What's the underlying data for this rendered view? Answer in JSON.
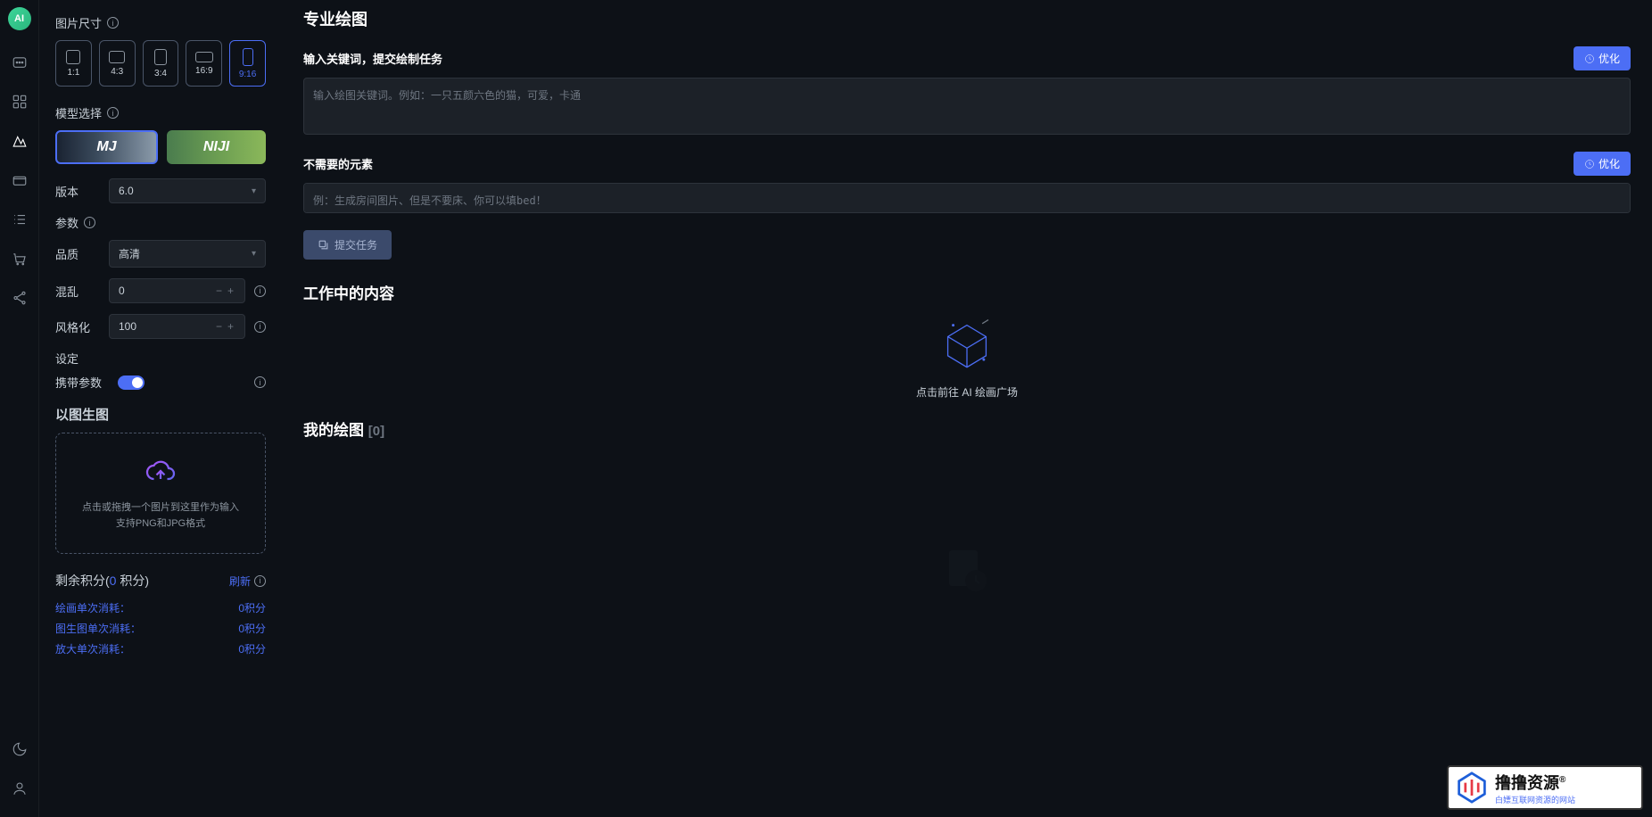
{
  "logo": "AI",
  "sidebar": {
    "size_label": "图片尺寸",
    "ratios": [
      "1:1",
      "4:3",
      "3:4",
      "16:9",
      "9:16"
    ],
    "model_label": "模型选择",
    "models": [
      "MJ",
      "NIJI"
    ],
    "version_label": "版本",
    "version_value": "6.0",
    "params_label": "参数",
    "quality_label": "品质",
    "quality_value": "高清",
    "chaos_label": "混乱",
    "chaos_value": "0",
    "stylize_label": "风格化",
    "stylize_value": "100",
    "settings_label": "设定",
    "carry_params_label": "携带参数",
    "img2img_label": "以图生图",
    "upload_text1": "点击或拖拽一个图片到这里作为输入",
    "upload_text2": "支持PNG和JPG格式",
    "credits_label_prefix": "剩余积分(",
    "credits_value": "0",
    "credits_label_suffix": " 积分)",
    "refresh_label": "刷新",
    "credit_rows": [
      {
        "label": "绘画单次消耗：",
        "value": "0积分"
      },
      {
        "label": "图生图单次消耗：",
        "value": "0积分"
      },
      {
        "label": "放大单次消耗：",
        "value": "0积分"
      }
    ]
  },
  "main": {
    "title": "专业绘图",
    "prompt_label": "输入关键词，提交绘制任务",
    "optimize_label": "优化",
    "prompt_placeholder": "输入绘图关键词。例如：一只五颜六色的猫，可爱，卡通",
    "negative_label": "不需要的元素",
    "negative_placeholder": "例：生成房间图片、但是不要床、你可以填bed！",
    "submit_label": "提交任务",
    "working_title": "工作中的内容",
    "empty_working": "点击前往 AI 绘画广场",
    "mydraw_title": "我的绘图",
    "mydraw_count": "[0]"
  },
  "watermark": {
    "main": "撸撸资源",
    "reg": "®",
    "sub": "白嫖互联网资源的网站"
  }
}
